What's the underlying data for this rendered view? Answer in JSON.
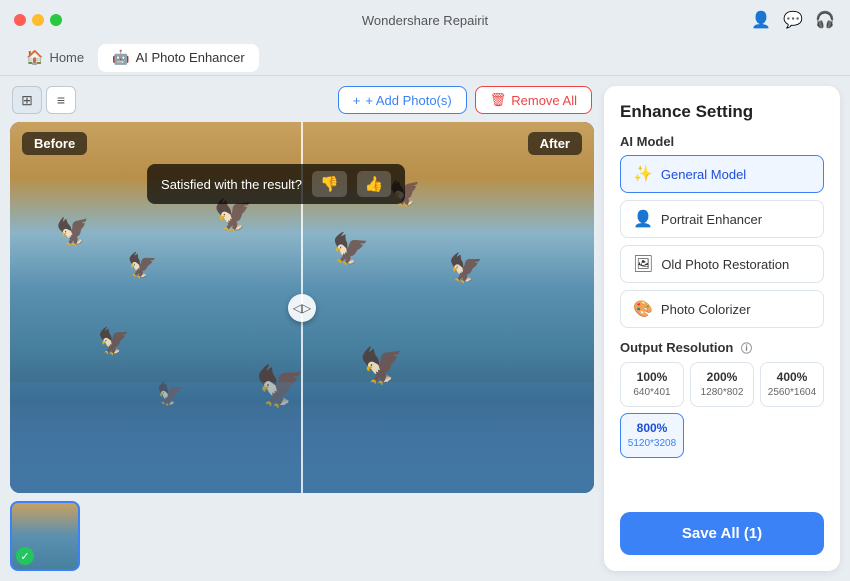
{
  "app": {
    "title": "Wondershare Repairit"
  },
  "navbar": {
    "home_label": "Home",
    "tab_label": "AI Photo Enhancer"
  },
  "toolbar": {
    "add_label": "+ Add Photo(s)",
    "remove_label": "Remove All"
  },
  "viewer": {
    "before_label": "Before",
    "after_label": "After",
    "satisfaction_text": "Satisfied with the result?"
  },
  "right_panel": {
    "title": "Enhance Setting",
    "ai_model_label": "AI Model",
    "models": [
      {
        "id": "general",
        "label": "General Model",
        "selected": true
      },
      {
        "id": "portrait",
        "label": "Portrait Enhancer",
        "selected": false
      },
      {
        "id": "oldphoto",
        "label": "Old Photo Restoration",
        "selected": false
      },
      {
        "id": "colorizer",
        "label": "Photo Colorizer",
        "selected": false
      }
    ],
    "resolution_label": "Output Resolution",
    "resolutions": [
      {
        "percent": "100%",
        "dims": "640*401",
        "selected": false
      },
      {
        "percent": "200%",
        "dims": "1280*802",
        "selected": false
      },
      {
        "percent": "400%",
        "dims": "2560*1604",
        "selected": false
      },
      {
        "percent": "800%",
        "dims": "5120*3208",
        "selected": true
      }
    ],
    "save_label": "Save All (1)"
  },
  "icons": {
    "grid_icon": "⊞",
    "list_icon": "≡",
    "add_icon": "+",
    "remove_icon": "🗑",
    "divider_handle": "◁▷",
    "thumbdown": "👎",
    "thumbup": "👍",
    "check": "✓",
    "user_icon": "👤",
    "chat_icon": "💬",
    "headset_icon": "🎧",
    "general_icon": "✨",
    "portrait_icon": "👤",
    "oldphoto_icon": "🖼",
    "colorizer_icon": "🎨"
  }
}
